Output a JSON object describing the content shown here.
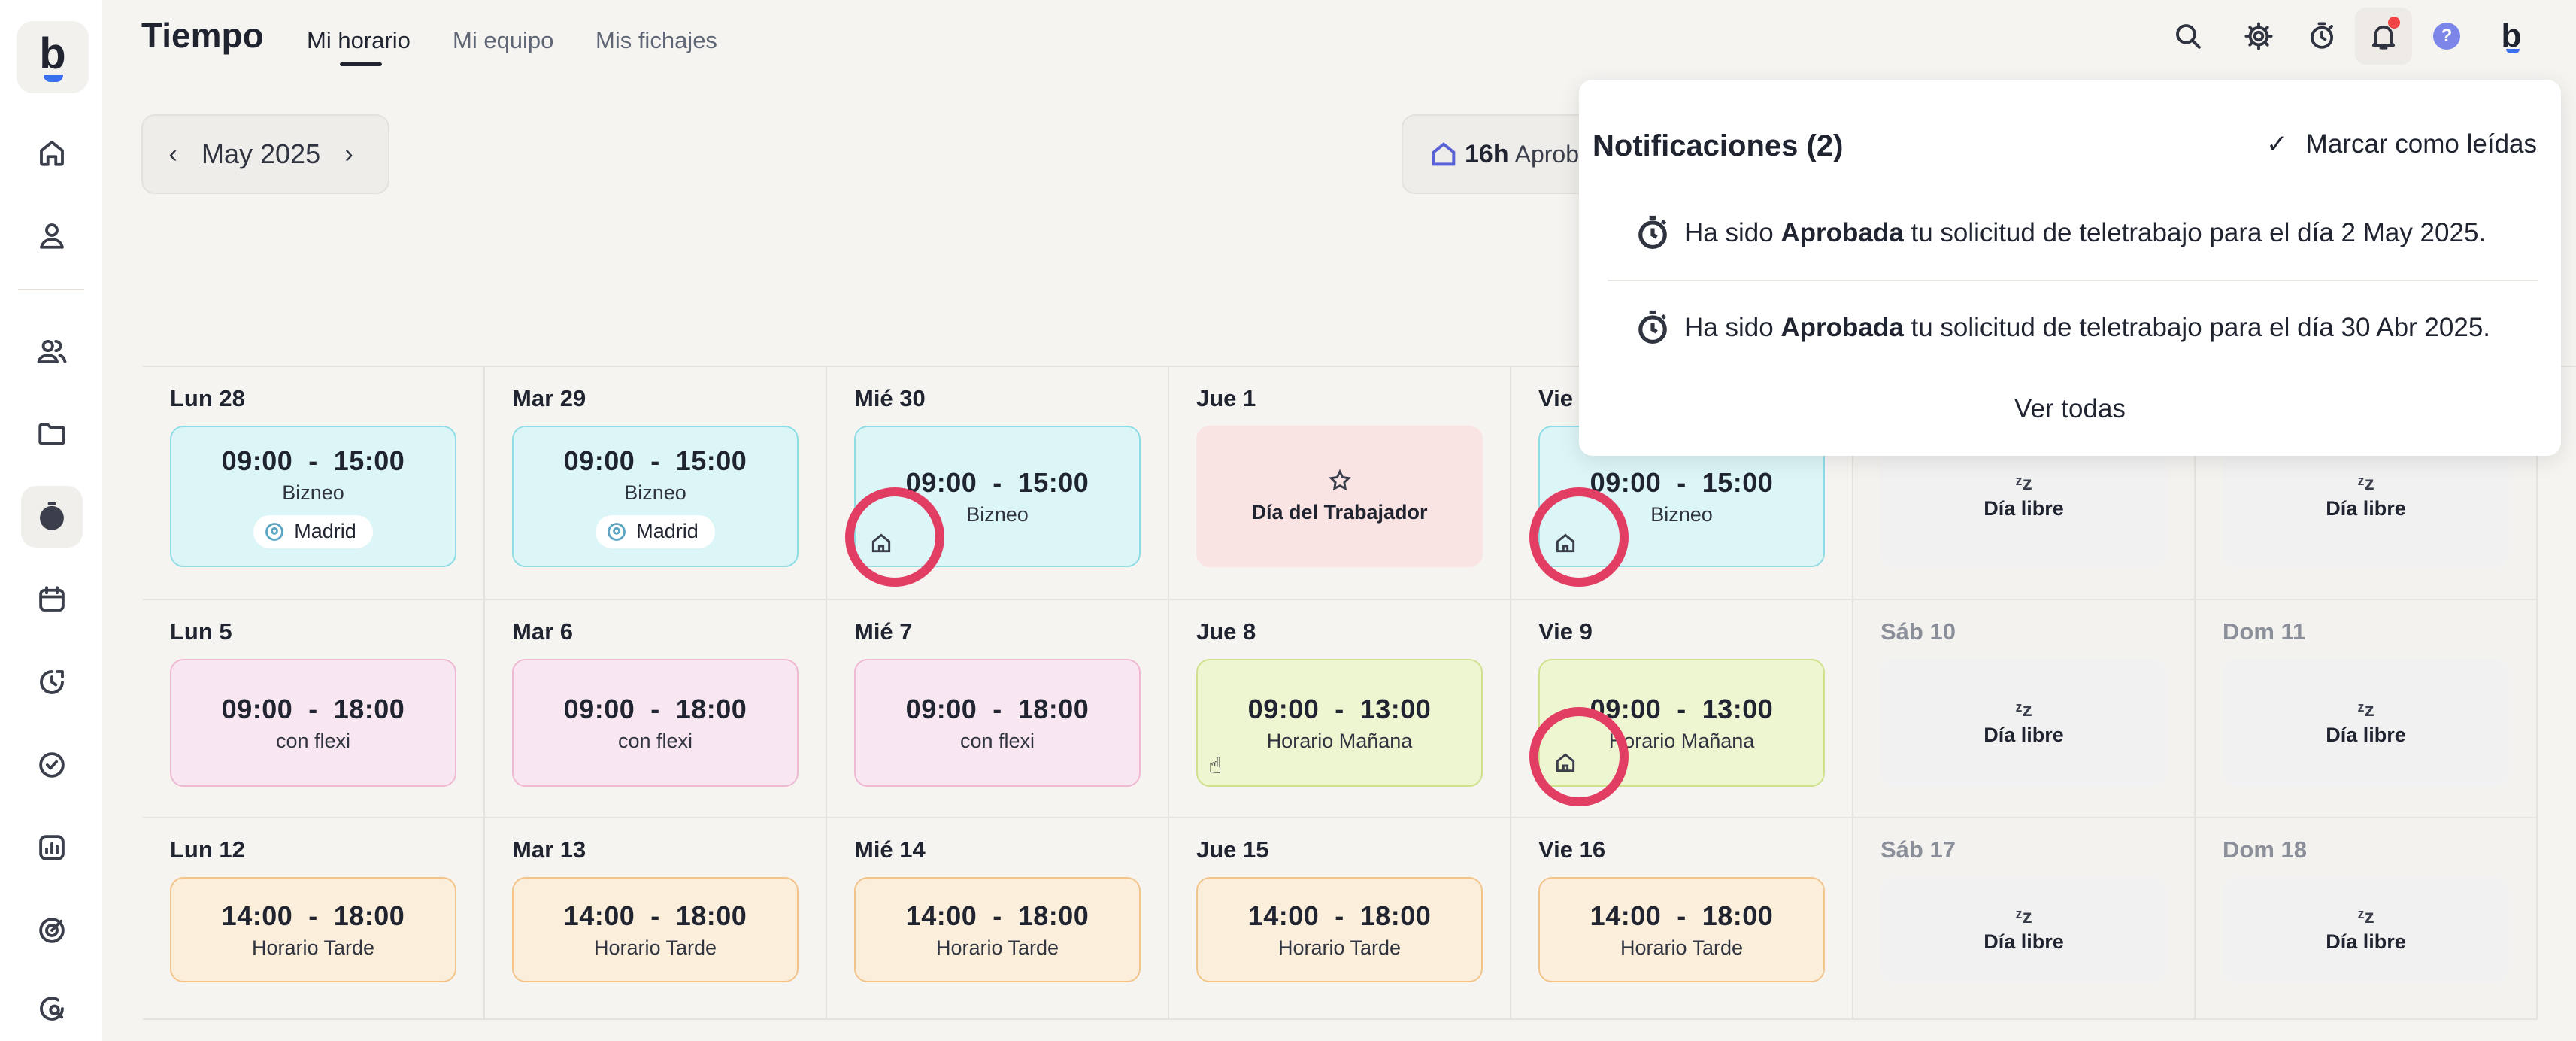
{
  "app": {
    "title": "Tiempo",
    "logo_letter": "b"
  },
  "tabs": [
    {
      "label": "Mi horario",
      "active": true
    },
    {
      "label": "Mi equipo",
      "active": false
    },
    {
      "label": "Mis fichajes",
      "active": false
    }
  ],
  "sidebar": {
    "items": [
      {
        "icon": "home-icon"
      },
      {
        "icon": "user-icon"
      },
      {
        "icon": "team-icon"
      },
      {
        "icon": "folder-icon"
      },
      {
        "icon": "stopwatch-icon",
        "active": true
      },
      {
        "icon": "calendar-icon"
      },
      {
        "icon": "clock-chart-icon"
      },
      {
        "icon": "check-circle-icon"
      },
      {
        "icon": "analytics-icon"
      },
      {
        "icon": "target-icon"
      },
      {
        "icon": "chat-search-icon"
      }
    ]
  },
  "toolbar": {
    "month_label": "May 2025",
    "prev": "‹",
    "next": "›",
    "summary_hours": "16h",
    "summary_label": "Aprob"
  },
  "topbar": {
    "icons": [
      "search-icon",
      "gear-icon",
      "stopwatch-icon",
      "bell-icon",
      "help-icon",
      "avatar"
    ],
    "help_text": "?",
    "avatar_letter": "b"
  },
  "notifications": {
    "title": "Notificaciones (2)",
    "mark_read_label": "Marcar como leídas",
    "items": [
      {
        "pre": "Ha sido ",
        "bold": "Aprobada",
        "post": " tu solicitud de teletrabajo para el día 2 May 2025."
      },
      {
        "pre": "Ha sido ",
        "bold": "Aprobada",
        "post": " tu solicitud de teletrabajo para el día 30 Abr 2025."
      }
    ],
    "see_all_label": "Ver todas"
  },
  "calendar": {
    "rows": [
      [
        {
          "day": "Lun 28",
          "type": "cyan",
          "time": "09:00  -  15:00",
          "name": "Bizneo",
          "location": "Madrid"
        },
        {
          "day": "Mar 29",
          "type": "cyan",
          "time": "09:00  -  15:00",
          "name": "Bizneo",
          "location": "Madrid"
        },
        {
          "day": "Mié 30",
          "type": "cyan",
          "time": "09:00  -  15:00",
          "name": "Bizneo",
          "remote": true,
          "highlight": true
        },
        {
          "day": "Jue 1",
          "type": "holiday",
          "name": "Día del Trabajador"
        },
        {
          "day": "Vie",
          "type": "cyan",
          "time": "09:00  -  15:00",
          "name": "Bizneo",
          "remote": true,
          "highlight": true
        },
        {
          "day": "",
          "type": "free",
          "name": "Día libre",
          "weekend": true
        },
        {
          "day": "",
          "type": "free",
          "name": "Día libre",
          "weekend": true
        }
      ],
      [
        {
          "day": "Lun 5",
          "type": "pink",
          "time": "09:00  -  18:00",
          "name": "con flexi"
        },
        {
          "day": "Mar 6",
          "type": "pink",
          "time": "09:00  -  18:00",
          "name": "con flexi"
        },
        {
          "day": "Mié 7",
          "type": "pink",
          "time": "09:00  -  18:00",
          "name": "con flexi"
        },
        {
          "day": "Jue 8",
          "type": "lime",
          "time": "09:00  -  13:00",
          "name": "Horario Mañana",
          "cursor": true
        },
        {
          "day": "Vie 9",
          "type": "lime",
          "time": "09:00  -  13:00",
          "name": "Horario Mañana",
          "remote": true,
          "highlight": true
        },
        {
          "day": "Sáb 10",
          "type": "free",
          "name": "Día libre",
          "weekend": true
        },
        {
          "day": "Dom 11",
          "type": "free",
          "name": "Día libre",
          "weekend": true
        }
      ],
      [
        {
          "day": "Lun 12",
          "type": "orange",
          "time": "14:00  -  18:00",
          "name": "Horario Tarde"
        },
        {
          "day": "Mar 13",
          "type": "orange",
          "time": "14:00  -  18:00",
          "name": "Horario Tarde"
        },
        {
          "day": "Mié 14",
          "type": "orange",
          "time": "14:00  -  18:00",
          "name": "Horario Tarde"
        },
        {
          "day": "Jue 15",
          "type": "orange",
          "time": "14:00  -  18:00",
          "name": "Horario Tarde"
        },
        {
          "day": "Vie 16",
          "type": "orange",
          "time": "14:00  -  18:00",
          "name": "Horario Tarde"
        },
        {
          "day": "Sáb 17",
          "type": "free",
          "name": "Día libre",
          "weekend": true
        },
        {
          "day": "Dom 18",
          "type": "free",
          "name": "Día libre",
          "weekend": true
        }
      ]
    ],
    "free_glyph": "ᶻz"
  },
  "colors": {
    "accent": "#3a6ff0",
    "highlight_ring": "#e23e63",
    "notification_dot": "#ef4444"
  }
}
